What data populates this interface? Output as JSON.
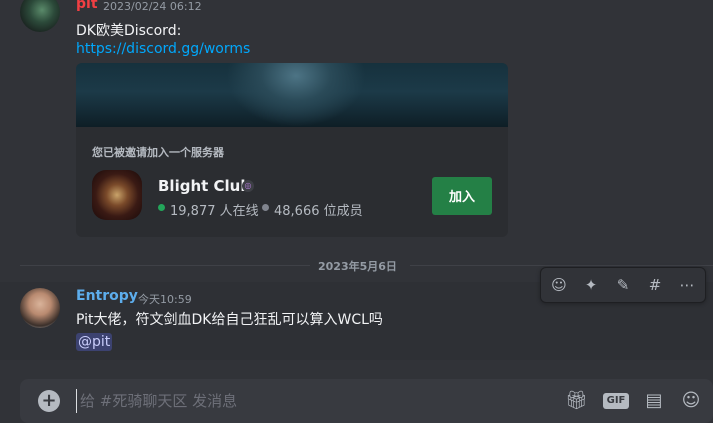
{
  "message1": {
    "author": "pit",
    "timestamp": "2023/02/24 06:12",
    "text": "DK欧美Discord:",
    "link": "https://discord.gg/worms"
  },
  "invite": {
    "heading": "您已被邀请加入一个服务器",
    "server_name": "Blight Club",
    "online": "19,877 人在线",
    "members": "48,666 位成员",
    "join_label": "加入"
  },
  "date_divider": "2023年5月6日",
  "message2": {
    "author": "Entropy",
    "timestamp": "今天10:59",
    "text": "Pit大佬，符文剑血DK给自己狂乱可以算入WCL吗",
    "mention": "@pit"
  },
  "composer": {
    "placeholder": "给 #死骑聊天区 发消息",
    "gif_label": "GIF"
  },
  "colors": {
    "author1": "#f23f43",
    "author2": "#5dadec",
    "link": "#00a8fc",
    "join": "#248046",
    "online": "#23a55a"
  }
}
